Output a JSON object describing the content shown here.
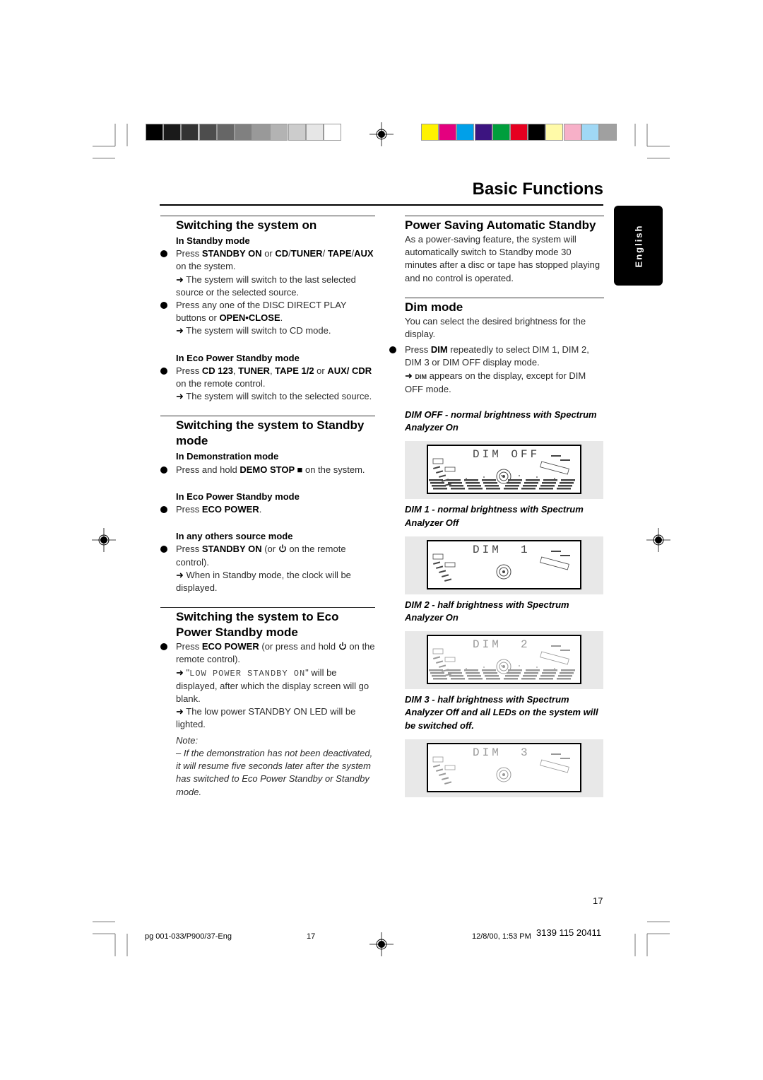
{
  "colors": {
    "grays": [
      "#000000",
      "#1a1a1a",
      "#333333",
      "#4d4d4d",
      "#666666",
      "#808080",
      "#999999",
      "#b3b3b3",
      "#cccccc",
      "#e6e6e6",
      "#ffffff"
    ],
    "process": [
      "#fff200",
      "#e4007f",
      "#00a0e9",
      "#3c1480",
      "#009e3c",
      "#e60020",
      "#000000",
      "#fffaa8",
      "#f7b0c8",
      "#a0d8f5",
      "#a0a0a0"
    ]
  },
  "header": {
    "title": "Basic Functions",
    "language_tab": "English"
  },
  "left": [
    {
      "type": "rule"
    },
    {
      "type": "h",
      "text": "Switching the system on"
    },
    {
      "type": "sub",
      "text": "In Standby mode"
    },
    {
      "type": "bullet",
      "segs": [
        [
          "Press ",
          ""
        ],
        [
          "STANDBY ON",
          "b"
        ],
        [
          " or ",
          ""
        ],
        [
          "CD",
          "b"
        ],
        [
          "/",
          ""
        ],
        [
          "TUNER",
          "b"
        ],
        [
          "/ ",
          ""
        ],
        [
          "TAPE",
          "b"
        ],
        [
          "/",
          ""
        ],
        [
          "AUX",
          "b"
        ],
        [
          " on the system.",
          ""
        ]
      ]
    },
    {
      "type": "arrow",
      "segs": [
        [
          "The system will switch to the last selected source or the selected source.",
          ""
        ]
      ]
    },
    {
      "type": "bullet",
      "segs": [
        [
          "Press any one of the DISC DIRECT PLAY buttons or ",
          ""
        ],
        [
          "OPEN•CLOSE",
          "b"
        ],
        [
          ".",
          ""
        ]
      ]
    },
    {
      "type": "arrow",
      "segs": [
        [
          "The system will switch to CD mode.",
          ""
        ]
      ]
    },
    {
      "type": "gap"
    },
    {
      "type": "sub",
      "text": "In Eco Power Standby mode"
    },
    {
      "type": "bullet",
      "segs": [
        [
          "Press ",
          ""
        ],
        [
          "CD 123",
          "b"
        ],
        [
          ", ",
          ""
        ],
        [
          "TUNER",
          "b"
        ],
        [
          ", ",
          ""
        ],
        [
          "TAPE 1/2",
          "b"
        ],
        [
          " or ",
          ""
        ],
        [
          "AUX/ CDR",
          "b"
        ],
        [
          " on the remote control.",
          ""
        ]
      ]
    },
    {
      "type": "arrow",
      "segs": [
        [
          "The system will switch to the selected source.",
          ""
        ]
      ]
    },
    {
      "type": "gap"
    },
    {
      "type": "rule"
    },
    {
      "type": "h",
      "text": "Switching the system to Standby mode"
    },
    {
      "type": "sub",
      "text": "In Demonstration mode"
    },
    {
      "type": "bullet",
      "segs": [
        [
          "Press and hold ",
          ""
        ],
        [
          "DEMO STOP ■",
          "b"
        ],
        [
          "  on the system.",
          ""
        ]
      ]
    },
    {
      "type": "gap"
    },
    {
      "type": "sub",
      "text": "In Eco Power Standby mode"
    },
    {
      "type": "bullet",
      "segs": [
        [
          "Press ",
          ""
        ],
        [
          "ECO POWER",
          "b"
        ],
        [
          ".",
          ""
        ]
      ]
    },
    {
      "type": "gap"
    },
    {
      "type": "sub",
      "text": "In any others source mode"
    },
    {
      "type": "bullet",
      "segs": [
        [
          "Press ",
          ""
        ],
        [
          "STANDBY ON",
          "b"
        ],
        [
          " (or ",
          ""
        ],
        [
          "power",
          "icon"
        ],
        [
          " on the remote control).",
          ""
        ]
      ]
    },
    {
      "type": "arrow",
      "segs": [
        [
          "When in Standby mode, the clock will be displayed.",
          ""
        ]
      ]
    },
    {
      "type": "gap"
    },
    {
      "type": "rule"
    },
    {
      "type": "h",
      "text": "Switching the system to Eco Power Standby mode"
    },
    {
      "type": "bullet",
      "segs": [
        [
          "Press ",
          ""
        ],
        [
          "ECO POWER",
          "b"
        ],
        [
          " (or press and hold ",
          ""
        ],
        [
          "power",
          "icon"
        ],
        [
          " on the remote control).",
          ""
        ]
      ]
    },
    {
      "type": "arrow",
      "segs": [
        [
          "\"",
          ""
        ],
        [
          "LOW POWER STANDBY ON",
          "lcd"
        ],
        [
          "\" will be displayed, after which the display screen will go blank.",
          ""
        ]
      ]
    },
    {
      "type": "arrow",
      "segs": [
        [
          "The low power STANDBY ON LED will be lighted.",
          ""
        ]
      ]
    },
    {
      "type": "gap-s"
    },
    {
      "type": "note",
      "text": "Note:"
    },
    {
      "type": "note",
      "text": "–  If the demonstration has not been deactivated, it will resume five seconds later after the system has switched to Eco Power Standby or Standby mode."
    }
  ],
  "right": [
    {
      "type": "rule"
    },
    {
      "type": "h",
      "text": "Power Saving Automatic Standby"
    },
    {
      "type": "para",
      "segs": [
        [
          "As a power-saving feature, the system will automatically switch to Standby mode 30 minutes after a disc or tape has stopped playing and no control is operated.",
          ""
        ]
      ]
    },
    {
      "type": "gap"
    },
    {
      "type": "rule"
    },
    {
      "type": "h",
      "text": "Dim mode"
    },
    {
      "type": "para",
      "segs": [
        [
          "You can select the desired brightness for the display.",
          ""
        ]
      ]
    },
    {
      "type": "gap-s"
    },
    {
      "type": "bullet",
      "segs": [
        [
          "Press ",
          ""
        ],
        [
          "DIM",
          "b"
        ],
        [
          " repeatedly to select DIM 1, DIM 2, DIM 3 or DIM OFF display mode.",
          ""
        ]
      ]
    },
    {
      "type": "arrow",
      "segs": [
        [
          "DIM",
          "small"
        ],
        [
          " appears on the display, except for DIM OFF mode.",
          ""
        ]
      ]
    },
    {
      "type": "gap"
    },
    {
      "type": "caption",
      "text": "DIM OFF - normal brightness with Spectrum Analyzer On"
    },
    {
      "type": "display",
      "lcd": "DIM OFF",
      "spectrum": true,
      "brightness": "normal"
    },
    {
      "type": "caption",
      "text": "DIM 1 - normal brightness with Spectrum Analyzer Off"
    },
    {
      "type": "display",
      "lcd": "DIM  1",
      "spectrum": false,
      "brightness": "normal"
    },
    {
      "type": "caption",
      "text": "DIM 2 - half brightness with Spectrum Analyzer On"
    },
    {
      "type": "display",
      "lcd": "DIM  2",
      "spectrum": true,
      "brightness": "half"
    },
    {
      "type": "caption",
      "text": "DIM 3 - half brightness with Spectrum Analyzer Off and all LEDs on the system will be switched off."
    },
    {
      "type": "display",
      "lcd": "DIM  3",
      "spectrum": false,
      "brightness": "half"
    }
  ],
  "footer": {
    "page_number": "17",
    "file": "pg 001-033/P900/37-Eng",
    "file_page": "17",
    "datetime": "12/8/00, 1:53 PM",
    "code": "3139 115 20411"
  },
  "icons": {
    "arrow": "arrow-right-icon",
    "bullet": "bullet-icon",
    "power": "power-icon",
    "registration": "registration-mark-icon"
  }
}
